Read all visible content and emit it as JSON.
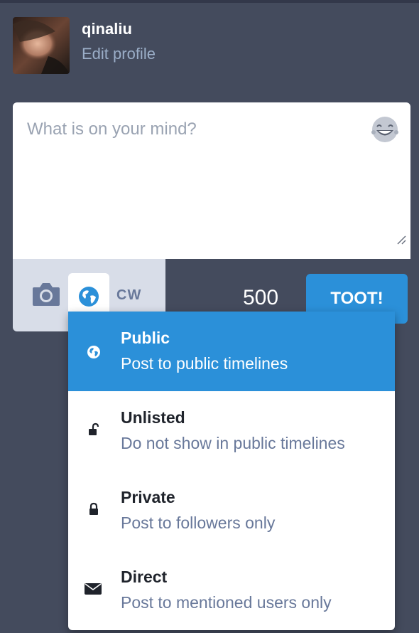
{
  "account": {
    "name": "qinaliu",
    "edit_profile": "Edit profile"
  },
  "compose": {
    "placeholder": "What is on your mind?",
    "char_count": "500",
    "cw_label": "CW",
    "toot_label": "TOOT!"
  },
  "privacy_options": [
    {
      "title": "Public",
      "desc": "Post to public timelines",
      "icon": "globe-icon",
      "active": true
    },
    {
      "title": "Unlisted",
      "desc": "Do not show in public timelines",
      "icon": "unlock-icon",
      "active": false
    },
    {
      "title": "Private",
      "desc": "Post to followers only",
      "icon": "lock-icon",
      "active": false
    },
    {
      "title": "Direct",
      "desc": "Post to mentioned users only",
      "icon": "envelope-icon",
      "active": false
    }
  ],
  "colors": {
    "background": "#444b5d",
    "accent": "#2b90d9",
    "muted_text": "#9baec8",
    "toolbar": "#d8dde8"
  }
}
